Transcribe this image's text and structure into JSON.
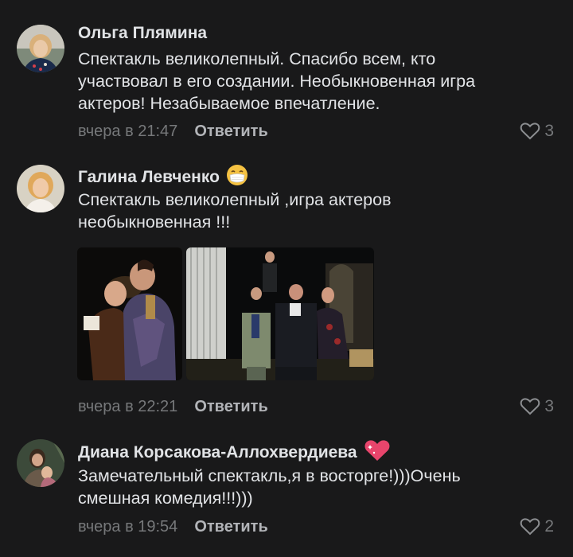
{
  "comments": [
    {
      "author": "Ольга Плямина",
      "text_lines": [
        "Спектакль великолепный. Спасибо всем, кто",
        "участвовал в его создании. Необыкновенная игра",
        "актеров! Незабываемое впечатление."
      ],
      "time": "вчера в 21:47",
      "reply_label": "Ответить",
      "likes": "3"
    },
    {
      "author": "Галина Левченко",
      "author_emoji": "face-with-medical-mask-icon",
      "text_lines": [
        "Спектакль великолепный ,игра актеров",
        "необыкновенная !!!"
      ],
      "time": "вчера в 22:21",
      "reply_label": "Ответить",
      "likes": "3"
    },
    {
      "author": "Диана Корсакова-Аллохвердиева",
      "author_emoji": "sparkling-heart-icon",
      "text_lines": [
        "Замечательный спектакль,я в восторге!)))Очень",
        "смешная комедия!!!)))"
      ],
      "time": "вчера в 19:54",
      "reply_label": "Ответить",
      "likes": "2"
    }
  ],
  "colors": {
    "background": "#19191a",
    "text": "#e1e3e6",
    "secondary": "#76787a",
    "reply": "#b2b4b8"
  }
}
